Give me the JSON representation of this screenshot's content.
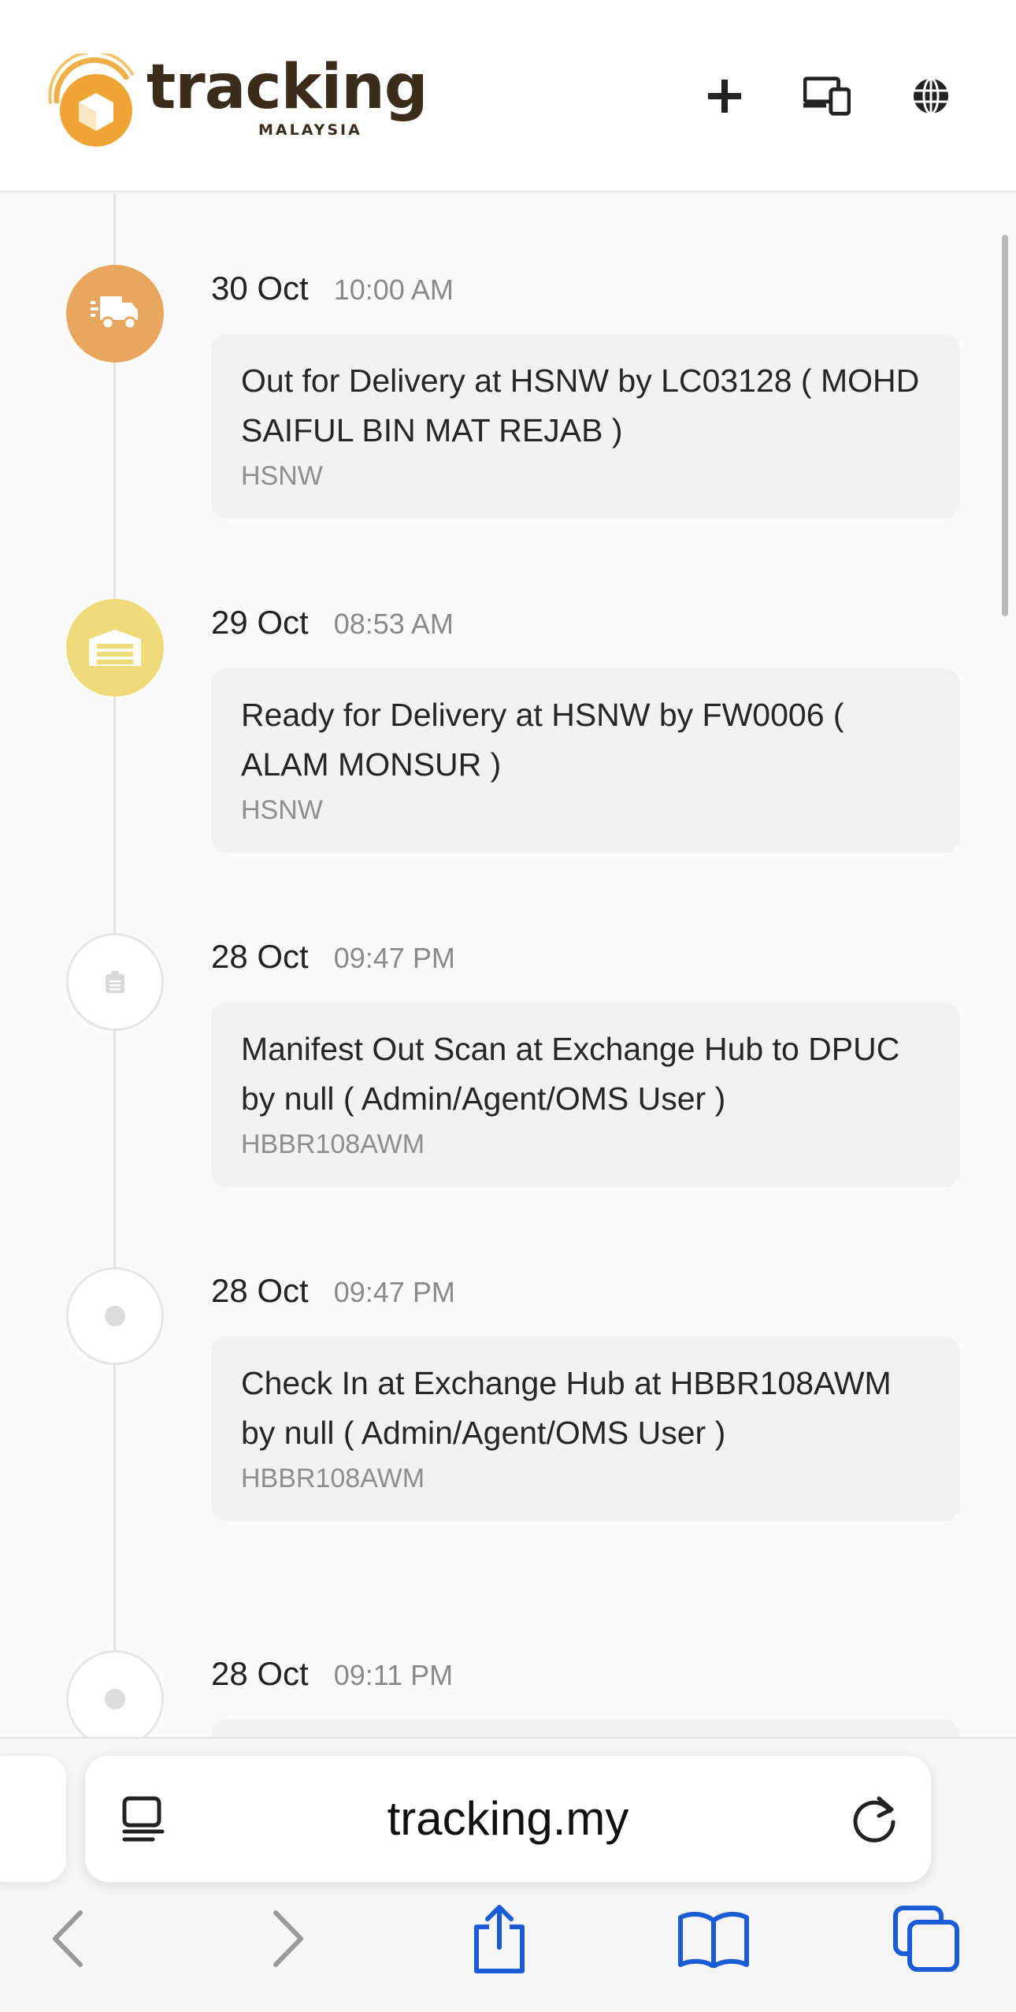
{
  "header": {
    "logo_word": "tracking",
    "logo_sub": "MALAYSIA",
    "icons": [
      "add-icon",
      "devices-icon",
      "globe-icon"
    ]
  },
  "events": [
    {
      "date": "30 Oct",
      "time": "10:00 AM",
      "description": "Out for Delivery at HSNW by LC03128 ( MOHD SAIFUL BIN MAT REJAB )",
      "location": "HSNW",
      "icon": "delivery-truck-icon",
      "status_color": "#e8a65e"
    },
    {
      "date": "29 Oct",
      "time": "08:53 AM",
      "description": "Ready for Delivery at HSNW by FW0006 ( ALAM MONSUR )",
      "location": "HSNW",
      "icon": "warehouse-icon",
      "status_color": "#f0db7a"
    },
    {
      "date": "28 Oct",
      "time": "09:47 PM",
      "description": "Manifest Out Scan at Exchange Hub to DPUC by null ( Admin/Agent/OMS User )",
      "location": "HBBR108AWM",
      "icon": "clipboard-icon",
      "status_color": "#ffffff"
    },
    {
      "date": "28 Oct",
      "time": "09:47 PM",
      "description": "Check In at Exchange Hub at HBBR108AWM by null ( Admin/Agent/OMS User )",
      "location": "HBBR108AWM",
      "icon": "dot-icon",
      "status_color": "#ffffff"
    },
    {
      "date": "28 Oct",
      "time": "09:11 PM",
      "icon": "dot-icon",
      "status_color": "#ffffff"
    }
  ],
  "browser": {
    "url": "tracking.my",
    "toolbar_icons": [
      "back-icon",
      "forward-icon",
      "share-icon",
      "bookmarks-icon",
      "tabs-icon"
    ],
    "accent": "#1a5bd6"
  }
}
